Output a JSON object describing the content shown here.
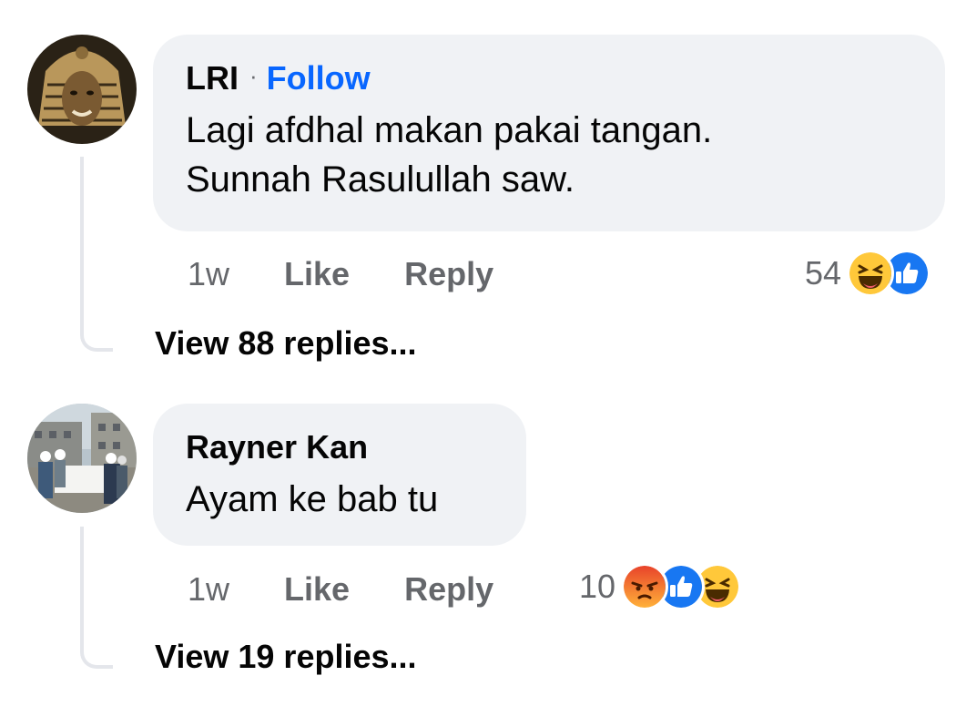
{
  "comments": [
    {
      "author": "LRI",
      "separator": "·",
      "follow_label": "Follow",
      "text_line1": "Lagi afdhal makan pakai tangan.",
      "text_line2": "Sunnah Rasulullah saw.",
      "time": "1w",
      "like_label": "Like",
      "reply_label": "Reply",
      "reaction_count": "54",
      "reactions": [
        "haha-icon",
        "like-icon"
      ],
      "view_replies": "View 88 replies..."
    },
    {
      "author": "Rayner Kan",
      "text_line1": "Ayam ke bab tu",
      "time": "1w",
      "like_label": "Like",
      "reply_label": "Reply",
      "reaction_count": "10",
      "reactions": [
        "angry-icon",
        "like-icon",
        "haha-icon"
      ],
      "view_replies": "View 19 replies..."
    }
  ],
  "colors": {
    "accent": "#0866ff",
    "bubble": "#f0f2f5",
    "muted": "#65676b",
    "thread_line": "#e4e6eb"
  }
}
